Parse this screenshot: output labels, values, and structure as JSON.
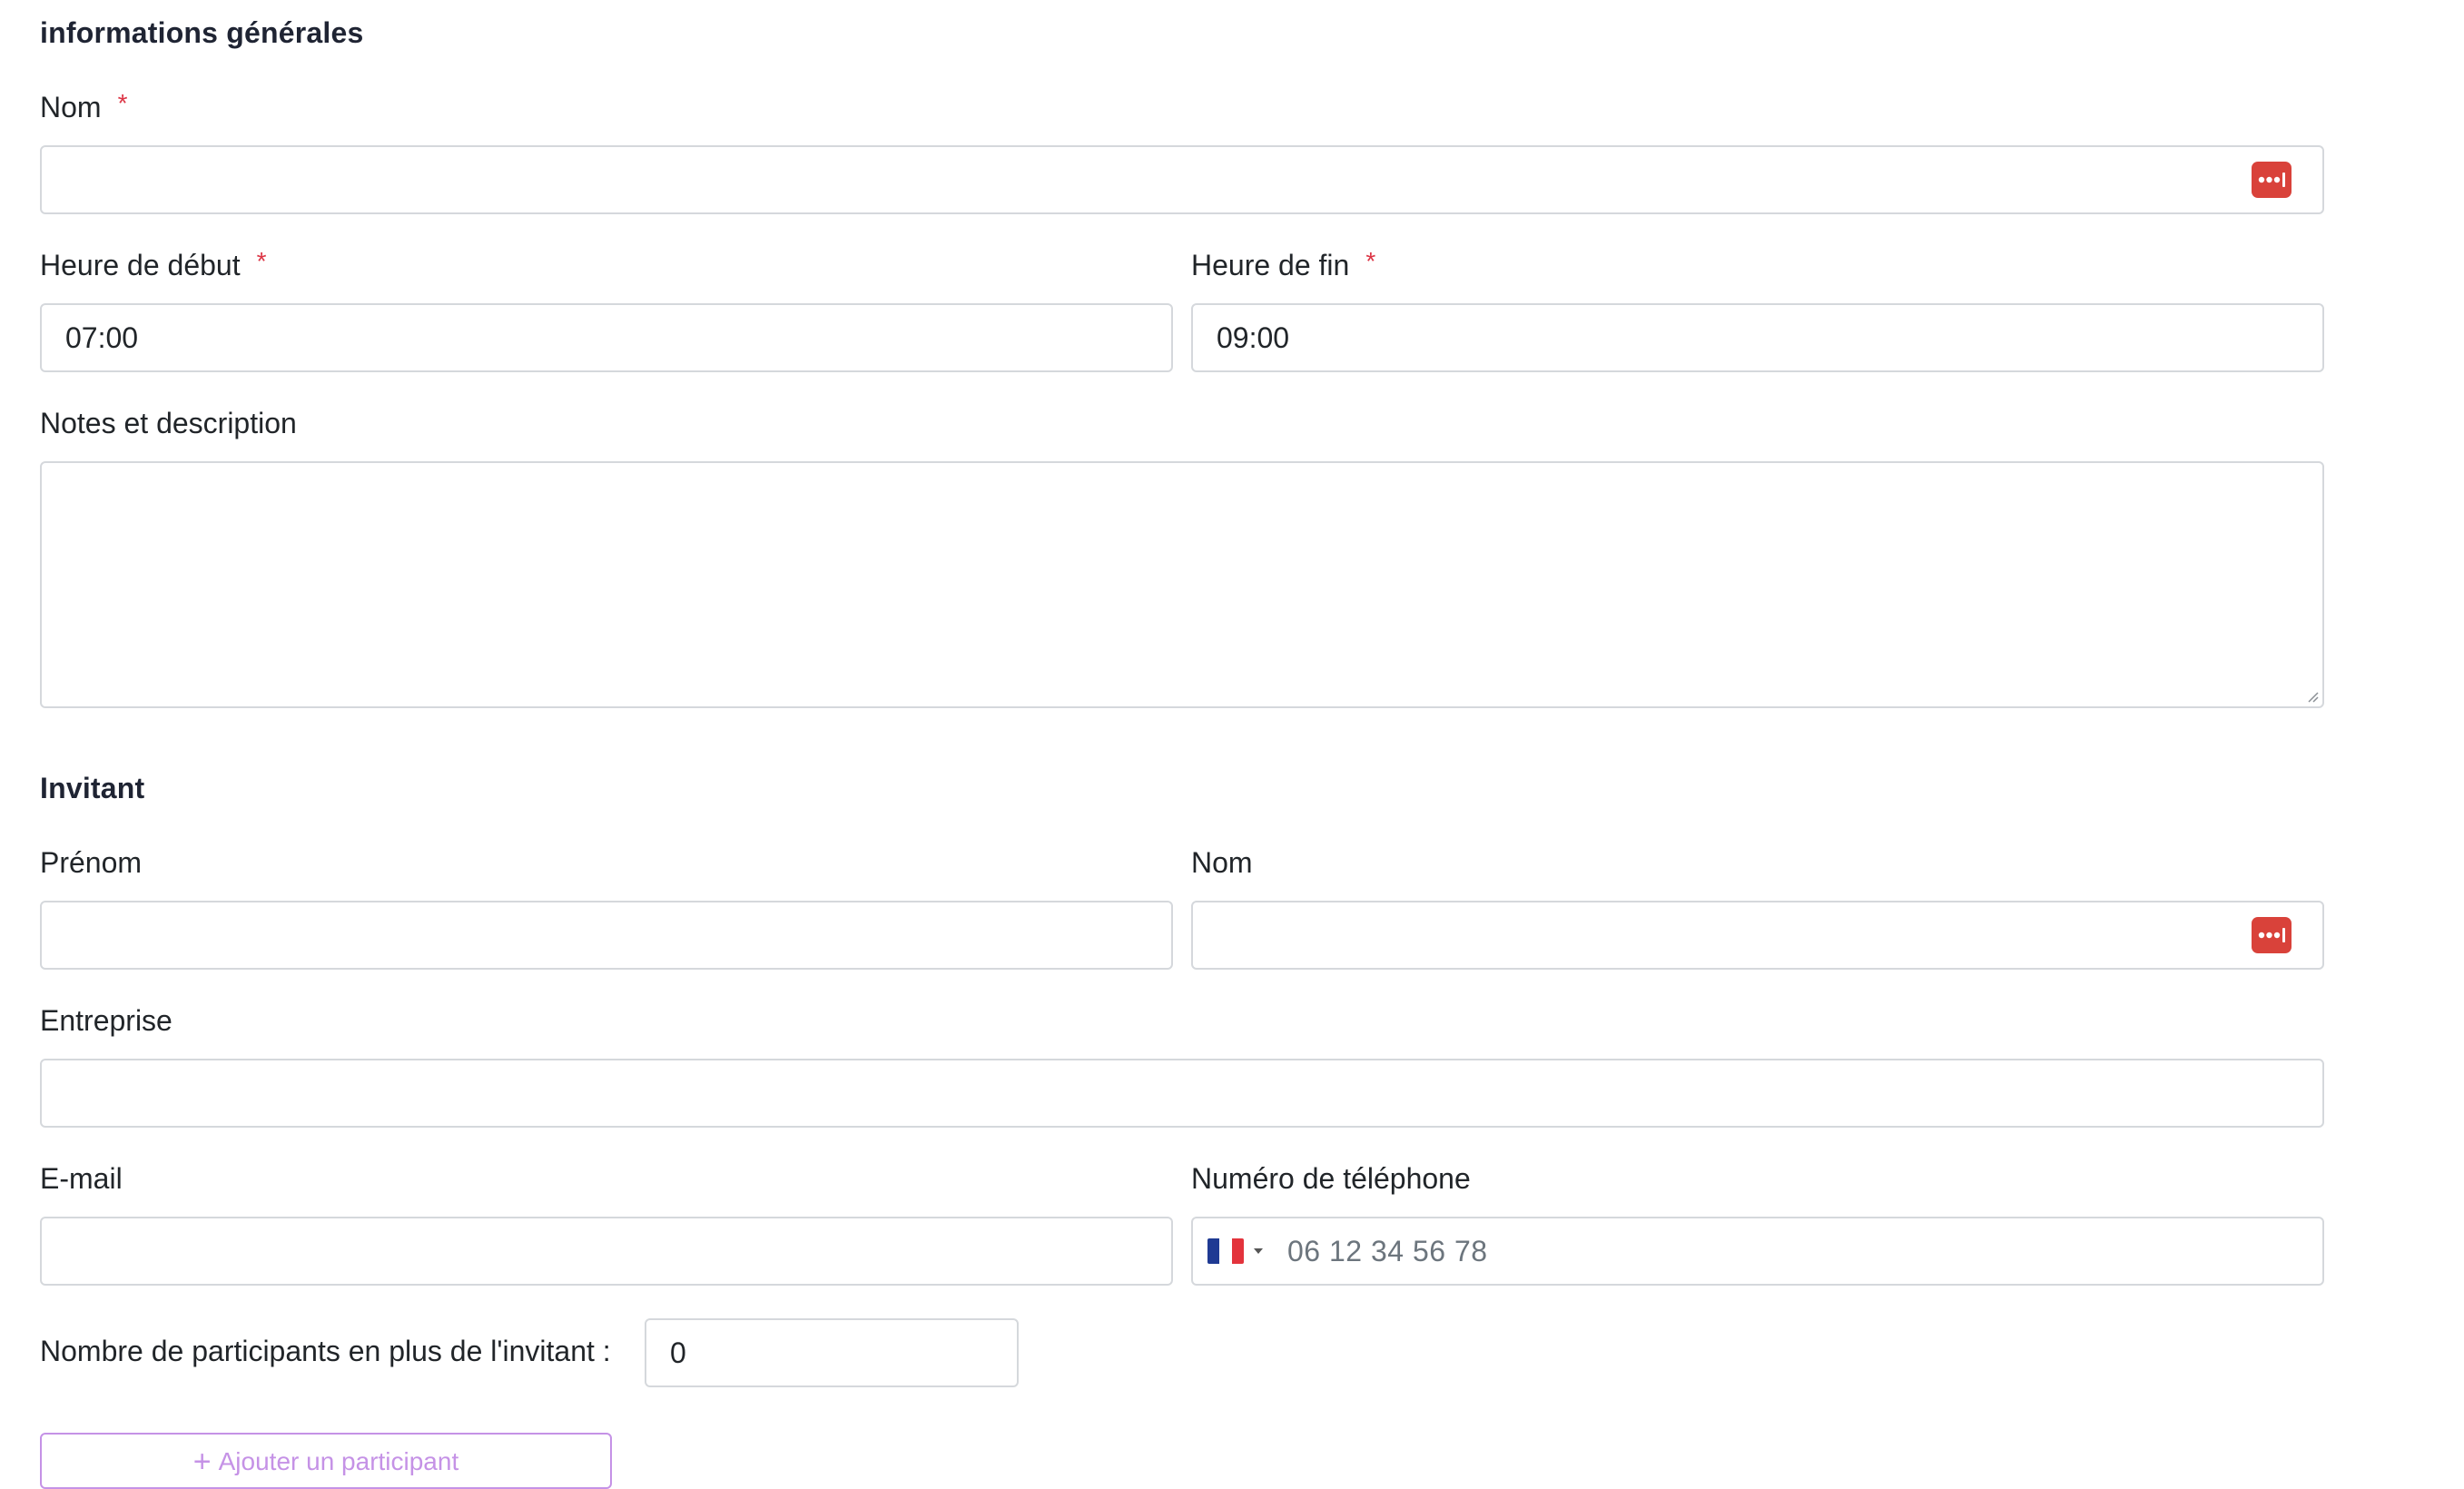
{
  "general": {
    "title": "informations générales",
    "name_label": "Nom",
    "name_value": "",
    "start_label": "Heure de début",
    "start_value": "07:00",
    "end_label": "Heure de fin",
    "end_value": "09:00",
    "notes_label": "Notes et description",
    "notes_value": "",
    "required_mark": "*"
  },
  "invitant": {
    "title": "Invitant",
    "firstname_label": "Prénom",
    "firstname_value": "",
    "lastname_label": "Nom",
    "lastname_value": "",
    "company_label": "Entreprise",
    "company_value": "",
    "email_label": "E-mail",
    "email_value": "",
    "phone_label": "Numéro de téléphone",
    "phone_placeholder": "06 12 34 56 78",
    "phone_country_icon": "france-flag-icon",
    "participants_label": "Nombre de participants en plus de l'invitant :",
    "participants_value": "0",
    "add_participant_label": "Ajouter un participant"
  },
  "colors": {
    "required": "#dc3545",
    "password_icon": "#d9423a",
    "add_button": "#c592e6",
    "border": "#d5d8dc"
  },
  "icons": {
    "password_manager": "password-manager-icon",
    "dropdown": "caret-down-icon",
    "add": "plus-icon"
  }
}
